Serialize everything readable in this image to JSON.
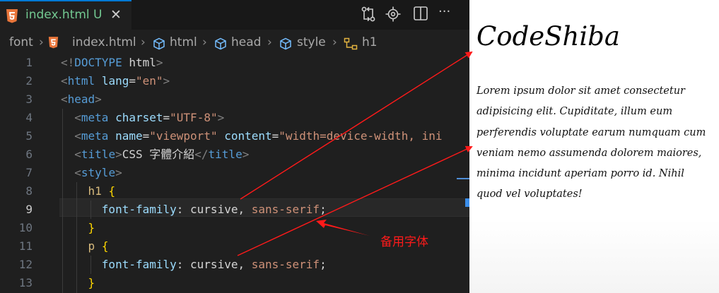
{
  "tab": {
    "label": "index.html",
    "status": "U",
    "close": "✕"
  },
  "editor_actions": [
    "compare-icon",
    "source-control-icon",
    "split-editor-icon",
    "more-icon"
  ],
  "editor_actions_glyphs": {
    "more": "···"
  },
  "breadcrumb": [
    {
      "label": "font",
      "icon": ""
    },
    {
      "label": "index.html",
      "icon": "html5-icon"
    },
    {
      "label": "html",
      "icon": "cube-icon"
    },
    {
      "label": "head",
      "icon": "cube-icon"
    },
    {
      "label": "style",
      "icon": "cube-icon"
    },
    {
      "label": "h1",
      "icon": "tree-node-icon"
    }
  ],
  "code": {
    "active_line": 9,
    "lines": [
      {
        "n": "1",
        "tokens": [
          [
            "pun",
            "<!"
          ],
          [
            "tag",
            "DOCTYPE"
          ],
          [
            "txt",
            " html"
          ],
          [
            "pun",
            ">"
          ]
        ]
      },
      {
        "n": "2",
        "tokens": [
          [
            "pun",
            "<"
          ],
          [
            "tag",
            "html"
          ],
          [
            "txt",
            " "
          ],
          [
            "attr",
            "lang"
          ],
          [
            "txt",
            "="
          ],
          [
            "str",
            "\"en\""
          ],
          [
            "pun",
            ">"
          ]
        ]
      },
      {
        "n": "3",
        "tokens": [
          [
            "pun",
            "<"
          ],
          [
            "tag",
            "head"
          ],
          [
            "pun",
            ">"
          ]
        ]
      },
      {
        "n": "4",
        "tokens": [
          [
            "txt",
            "  "
          ],
          [
            "pun",
            "<"
          ],
          [
            "tag",
            "meta"
          ],
          [
            "txt",
            " "
          ],
          [
            "attr",
            "charset"
          ],
          [
            "txt",
            "="
          ],
          [
            "str",
            "\"UTF-8\""
          ],
          [
            "pun",
            ">"
          ]
        ]
      },
      {
        "n": "5",
        "tokens": [
          [
            "txt",
            "  "
          ],
          [
            "pun",
            "<"
          ],
          [
            "tag",
            "meta"
          ],
          [
            "txt",
            " "
          ],
          [
            "attr",
            "name"
          ],
          [
            "txt",
            "="
          ],
          [
            "str",
            "\"viewport\""
          ],
          [
            "txt",
            " "
          ],
          [
            "attr",
            "content"
          ],
          [
            "txt",
            "="
          ],
          [
            "str",
            "\"width=device-width, ini"
          ]
        ]
      },
      {
        "n": "6",
        "tokens": [
          [
            "txt",
            "  "
          ],
          [
            "pun",
            "<"
          ],
          [
            "tag",
            "title"
          ],
          [
            "pun",
            ">"
          ],
          [
            "txt",
            "CSS 字體介紹"
          ],
          [
            "pun",
            "</"
          ],
          [
            "tag",
            "title"
          ],
          [
            "pun",
            ">"
          ]
        ]
      },
      {
        "n": "7",
        "tokens": [
          [
            "txt",
            "  "
          ],
          [
            "pun",
            "<"
          ],
          [
            "tag",
            "style"
          ],
          [
            "pun",
            ">"
          ]
        ]
      },
      {
        "n": "8",
        "tokens": [
          [
            "txt",
            "    "
          ],
          [
            "sel",
            "h1"
          ],
          [
            "txt",
            " "
          ],
          [
            "brace",
            "{"
          ]
        ]
      },
      {
        "n": "9",
        "tokens": [
          [
            "txt",
            "      "
          ],
          [
            "prop",
            "font-family"
          ],
          [
            "txt",
            ": "
          ],
          [
            "val",
            "cursive"
          ],
          [
            "txt",
            ", "
          ],
          [
            "str",
            "sans-serif"
          ],
          [
            "txt",
            ";"
          ]
        ]
      },
      {
        "n": "10",
        "tokens": [
          [
            "txt",
            "    "
          ],
          [
            "brace",
            "}"
          ]
        ]
      },
      {
        "n": "11",
        "tokens": [
          [
            "txt",
            "    "
          ],
          [
            "sel",
            "p"
          ],
          [
            "txt",
            " "
          ],
          [
            "brace",
            "{"
          ]
        ]
      },
      {
        "n": "12",
        "tokens": [
          [
            "txt",
            "      "
          ],
          [
            "prop",
            "font-family"
          ],
          [
            "txt",
            ": "
          ],
          [
            "val",
            "cursive"
          ],
          [
            "txt",
            ", "
          ],
          [
            "str",
            "sans-serif"
          ],
          [
            "txt",
            ";"
          ]
        ]
      },
      {
        "n": "13",
        "tokens": [
          [
            "txt",
            "    "
          ],
          [
            "brace",
            "}"
          ]
        ]
      }
    ]
  },
  "preview": {
    "title": "CodeShiba",
    "paragraph": "Lorem ipsum dolor sit amet consectetur adipisicing elit. Cupiditate, illum eum perferendis voluptate earum numquam cum veniam nemo assumenda dolorem maiores, minima incidunt aperiam porro id. Nihil quod vel voluptates!"
  },
  "annotation": {
    "label": "备用字体",
    "color": "#ff1a1a"
  },
  "colors": {
    "accent": "#0078d4",
    "untracked": "#73c991",
    "annotation": "#ff1a1a"
  }
}
